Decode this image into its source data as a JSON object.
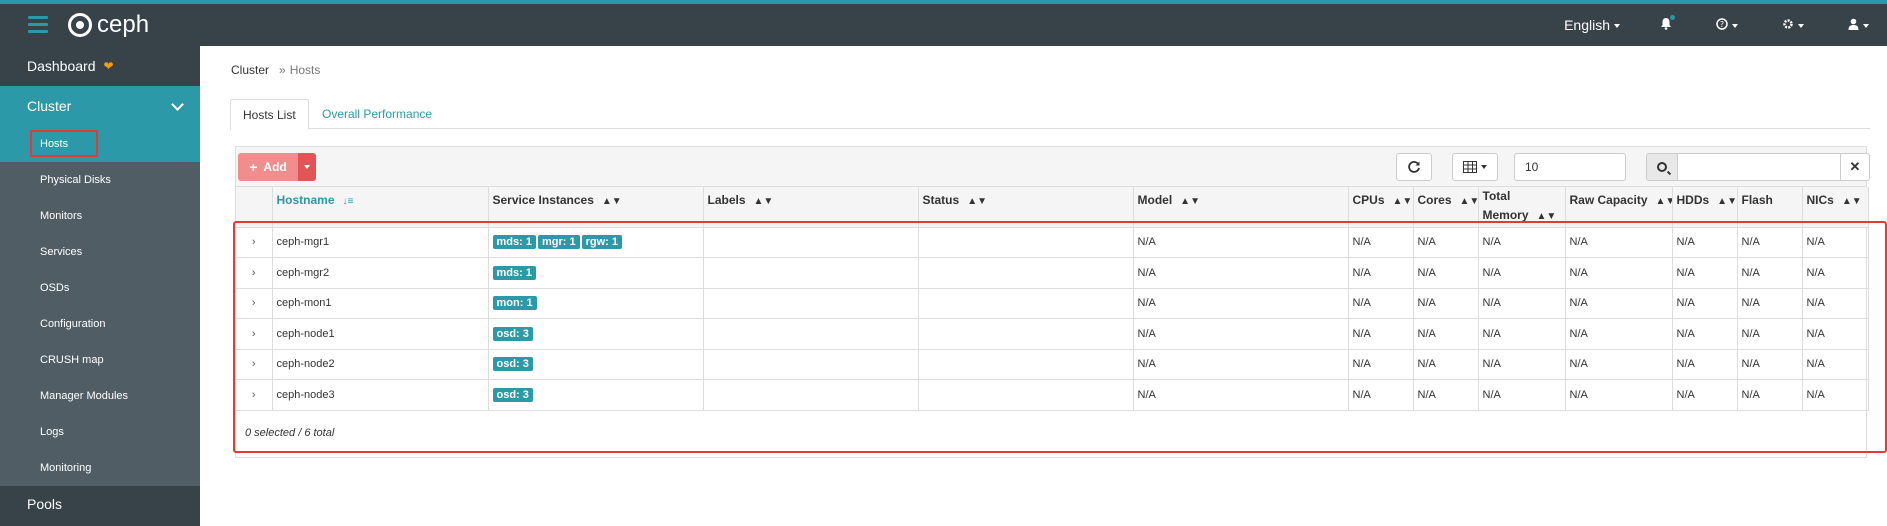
{
  "app": {
    "logo_text": "ceph"
  },
  "topnav": {
    "language": "English"
  },
  "sidebar": {
    "dashboard": "Dashboard",
    "cluster": "Cluster",
    "items": [
      "Hosts",
      "Physical Disks",
      "Monitors",
      "Services",
      "OSDs",
      "Configuration",
      "CRUSH map",
      "Manager Modules",
      "Logs",
      "Monitoring"
    ],
    "pools": "Pools"
  },
  "breadcrumb": {
    "parent": "Cluster",
    "current": "Hosts"
  },
  "tabs": {
    "hosts_list": "Hosts List",
    "overall_performance": "Overall Performance"
  },
  "toolbar": {
    "add_label": "Add",
    "page_size": "10",
    "search_value": ""
  },
  "table": {
    "headers": [
      "Hostname",
      "Service Instances",
      "Labels",
      "Status",
      "Model",
      "CPUs",
      "Cores",
      "Total Memory",
      "Raw Capacity",
      "HDDs",
      "Flash",
      "NICs"
    ],
    "rows": [
      {
        "hostname": "ceph-mgr1",
        "services": [
          "mds: 1",
          "mgr: 1",
          "rgw: 1"
        ],
        "labels": "",
        "status": "",
        "model": "N/A",
        "cpus": "N/A",
        "cores": "N/A",
        "memory": "N/A",
        "raw": "N/A",
        "hdds": "N/A",
        "flash": "N/A",
        "nics": "N/A"
      },
      {
        "hostname": "ceph-mgr2",
        "services": [
          "mds: 1"
        ],
        "labels": "",
        "status": "",
        "model": "N/A",
        "cpus": "N/A",
        "cores": "N/A",
        "memory": "N/A",
        "raw": "N/A",
        "hdds": "N/A",
        "flash": "N/A",
        "nics": "N/A"
      },
      {
        "hostname": "ceph-mon1",
        "services": [
          "mon: 1"
        ],
        "labels": "",
        "status": "",
        "model": "N/A",
        "cpus": "N/A",
        "cores": "N/A",
        "memory": "N/A",
        "raw": "N/A",
        "hdds": "N/A",
        "flash": "N/A",
        "nics": "N/A"
      },
      {
        "hostname": "ceph-node1",
        "services": [
          "osd: 3"
        ],
        "labels": "",
        "status": "",
        "model": "N/A",
        "cpus": "N/A",
        "cores": "N/A",
        "memory": "N/A",
        "raw": "N/A",
        "hdds": "N/A",
        "flash": "N/A",
        "nics": "N/A"
      },
      {
        "hostname": "ceph-node2",
        "services": [
          "osd: 3"
        ],
        "labels": "",
        "status": "",
        "model": "N/A",
        "cpus": "N/A",
        "cores": "N/A",
        "memory": "N/A",
        "raw": "N/A",
        "hdds": "N/A",
        "flash": "N/A",
        "nics": "N/A"
      },
      {
        "hostname": "ceph-node3",
        "services": [
          "osd: 3"
        ],
        "labels": "",
        "status": "",
        "model": "N/A",
        "cpus": "N/A",
        "cores": "N/A",
        "memory": "N/A",
        "raw": "N/A",
        "hdds": "N/A",
        "flash": "N/A",
        "nics": "N/A"
      }
    ],
    "footer": "0 selected / 6 total"
  },
  "colors": {
    "accent": "#2b99a8",
    "topbar": "#374249",
    "submenu": "#505d65",
    "add_button": "#f28d8d",
    "highlight": "#e53935"
  }
}
